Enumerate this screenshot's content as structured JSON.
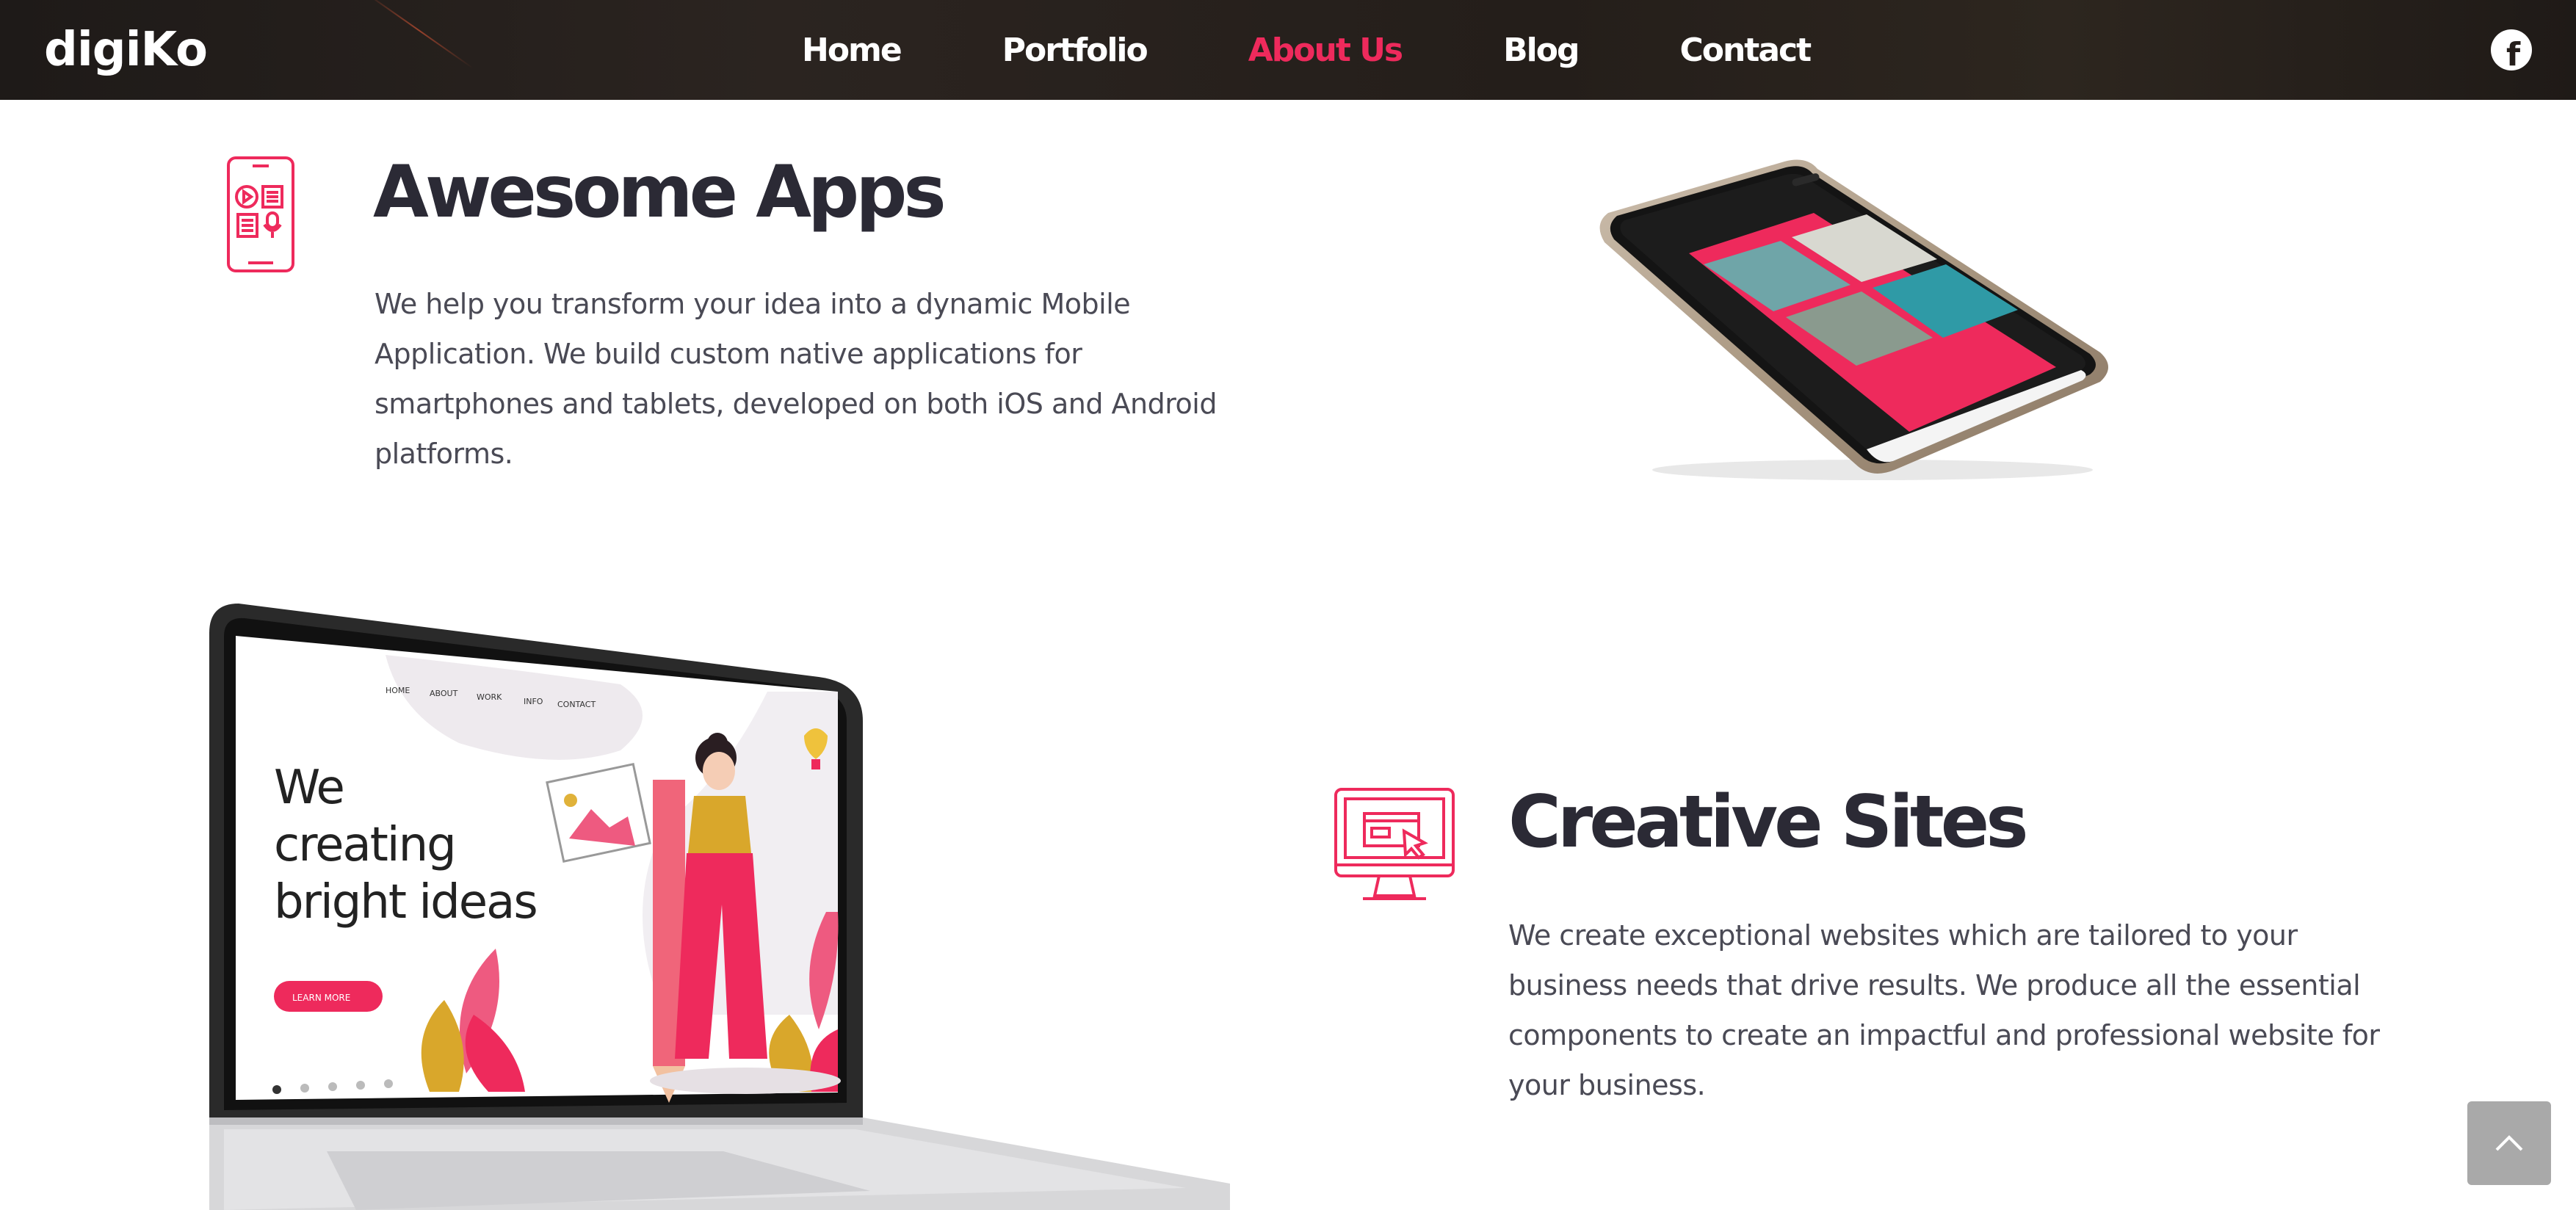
{
  "brand": {
    "logo_text": "digiKo"
  },
  "nav": {
    "items": [
      {
        "label": "Home",
        "active": false
      },
      {
        "label": "Portfolio",
        "active": false
      },
      {
        "label": "About Us",
        "active": true
      },
      {
        "label": "Blog",
        "active": false
      },
      {
        "label": "Contact",
        "active": false
      }
    ]
  },
  "social": {
    "facebook_icon": "facebook-icon",
    "glyph": "f"
  },
  "colors": {
    "accent": "#ee2a5c",
    "heading": "#2b2a35",
    "text": "#4a4a55",
    "header_bg": "#241e1a"
  },
  "sections": {
    "apps": {
      "icon": "mobile-app-icon",
      "title": "Awesome Apps",
      "text": "We help you transform your idea into a dynamic Mobile Application. We build custom native applications for smartphones and tablets, developed on both iOS and Android platforms."
    },
    "sites": {
      "icon": "monitor-icon",
      "title": "Creative Sites",
      "text": "We create exceptional websites which are tailored to your business needs that drive results. We produce all the essential components to create an impactful and professional website for your business."
    }
  },
  "laptop_screen": {
    "nav": [
      "HOME",
      "ABOUT",
      "WORK",
      "INFO",
      "CONTACT"
    ],
    "headline_lines": [
      "We",
      "creating",
      "bright ideas"
    ],
    "button": "LEARN MORE"
  },
  "back_to_top": {
    "icon": "chevron-up-icon"
  }
}
